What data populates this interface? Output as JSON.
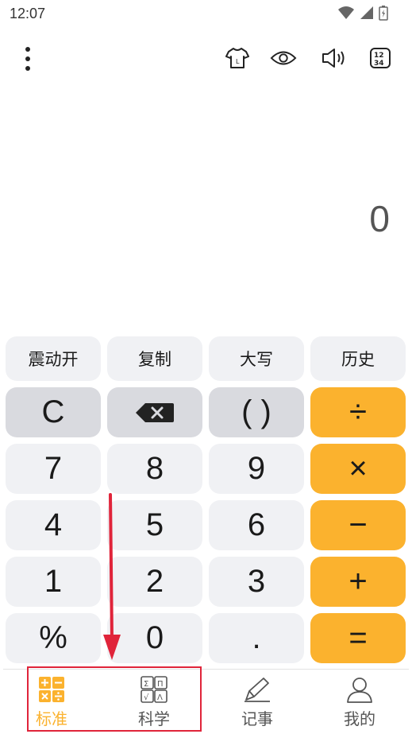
{
  "status_bar": {
    "time": "12:07"
  },
  "display": {
    "value": "0"
  },
  "function_keys": [
    "震动开",
    "复制",
    "大写",
    "历史"
  ],
  "keypad": {
    "row1": [
      "C",
      "⌫",
      "( )",
      "÷"
    ],
    "row2": [
      "7",
      "8",
      "9",
      "×"
    ],
    "row3": [
      "4",
      "5",
      "6",
      "−"
    ],
    "row4": [
      "1",
      "2",
      "3",
      "+"
    ],
    "row5": [
      "%",
      "0",
      ".",
      "="
    ]
  },
  "tabs": [
    {
      "label": "标准",
      "icon": "standard-calc-icon",
      "active": true
    },
    {
      "label": "科学",
      "icon": "scientific-calc-icon",
      "active": false
    },
    {
      "label": "记事",
      "icon": "pencil-icon",
      "active": false
    },
    {
      "label": "我的",
      "icon": "person-icon",
      "active": false
    }
  ],
  "colors": {
    "accent": "#fbb22e",
    "key_bg": "#f0f1f4",
    "gray_key_bg": "#d9dadf",
    "annotation": "#e0243a"
  }
}
